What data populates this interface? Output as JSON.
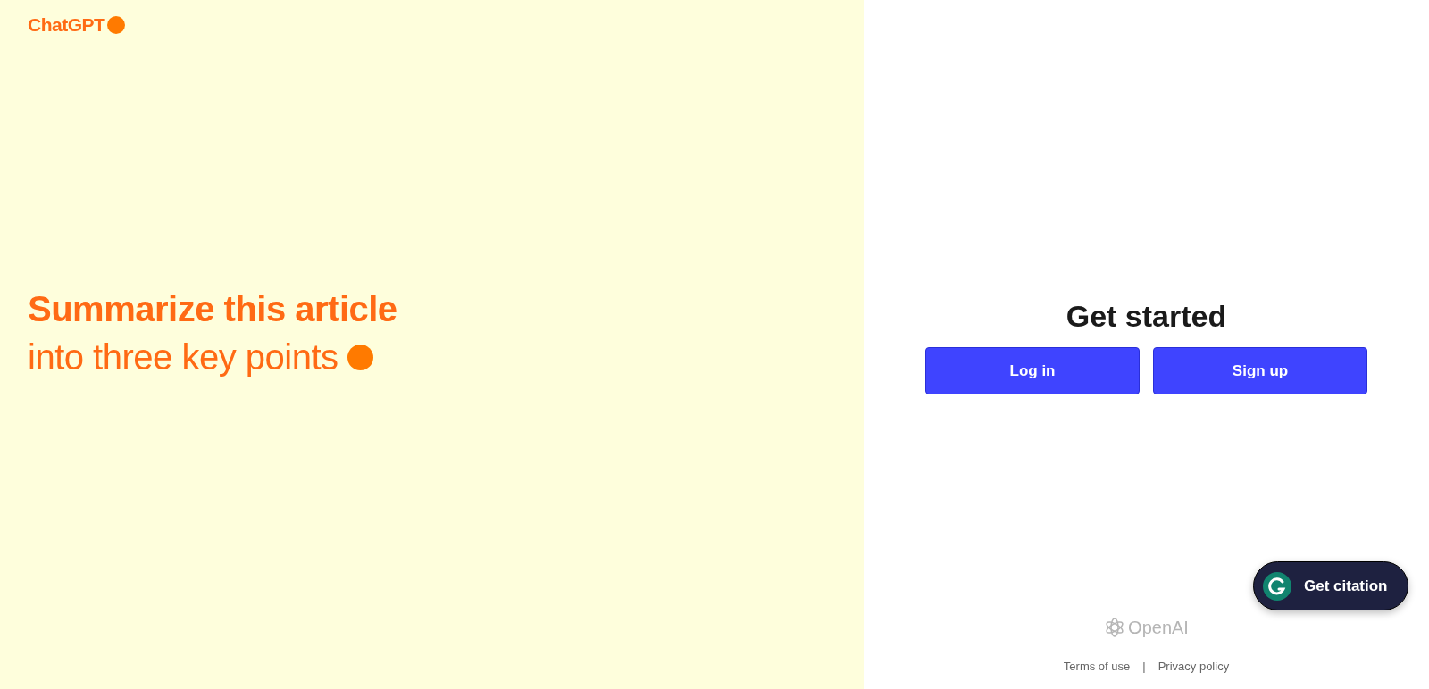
{
  "brand": {
    "name": "ChatGPT"
  },
  "hero": {
    "headline": "Summarize this article",
    "subline": "into three key points"
  },
  "auth": {
    "title": "Get started",
    "buttons": [
      "Log in",
      "Sign up"
    ]
  },
  "citation_button": {
    "label": "Get citation"
  },
  "footer": {
    "logo": "OpenAI",
    "links": [
      "Terms of use",
      "Privacy policy"
    ],
    "separator": "|"
  }
}
